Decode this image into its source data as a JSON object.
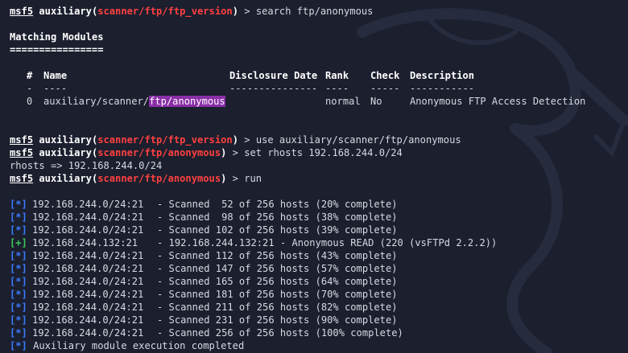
{
  "prompt": {
    "name": "msf5",
    "module_type": "auxiliary",
    "search_module": "scanner/ftp/ftp_version",
    "use_module": "scanner/ftp/anonymous"
  },
  "commands": {
    "search": "search ftp/anonymous",
    "use": "use auxiliary/scanner/ftp/anonymous",
    "set": "set rhosts 192.168.244.0/24",
    "run": "run"
  },
  "matching_modules": {
    "title": "Matching Modules",
    "underline": "================",
    "headers": {
      "index": "#",
      "name": "Name",
      "disclosure_date": "Disclosure Date",
      "rank": "Rank",
      "check": "Check",
      "description": "Description"
    },
    "dividers": {
      "index": "-",
      "name": "----",
      "disclosure_date": "---------------",
      "rank": "----",
      "check": "-----",
      "description": "-----------"
    },
    "row": {
      "index": "0",
      "name_prefix": "auxiliary/scanner/",
      "name_highlight": "ftp/anonymous",
      "disclosure_date": "",
      "rank": "normal",
      "check": "No",
      "description": "Anonymous FTP Access Detection"
    }
  },
  "rhosts_echo": "rhosts => 192.168.244.0/24",
  "output": [
    {
      "tag": "[*]",
      "type": "info",
      "host": "192.168.244.0/24:21",
      "msg": "- Scanned  52 of 256 hosts (20% complete)"
    },
    {
      "tag": "[*]",
      "type": "info",
      "host": "192.168.244.0/24:21",
      "msg": "- Scanned  98 of 256 hosts (38% complete)"
    },
    {
      "tag": "[*]",
      "type": "info",
      "host": "192.168.244.0/24:21",
      "msg": "- Scanned 102 of 256 hosts (39% complete)"
    },
    {
      "tag": "[+]",
      "type": "good",
      "host": "192.168.244.132:21",
      "msg": "- 192.168.244.132:21 - Anonymous READ (220 (vsFTPd 2.2.2))"
    },
    {
      "tag": "[*]",
      "type": "info",
      "host": "192.168.244.0/24:21",
      "msg": "- Scanned 112 of 256 hosts (43% complete)"
    },
    {
      "tag": "[*]",
      "type": "info",
      "host": "192.168.244.0/24:21",
      "msg": "- Scanned 147 of 256 hosts (57% complete)"
    },
    {
      "tag": "[*]",
      "type": "info",
      "host": "192.168.244.0/24:21",
      "msg": "- Scanned 165 of 256 hosts (64% complete)"
    },
    {
      "tag": "[*]",
      "type": "info",
      "host": "192.168.244.0/24:21",
      "msg": "- Scanned 181 of 256 hosts (70% complete)"
    },
    {
      "tag": "[*]",
      "type": "info",
      "host": "192.168.244.0/24:21",
      "msg": "- Scanned 211 of 256 hosts (82% complete)"
    },
    {
      "tag": "[*]",
      "type": "info",
      "host": "192.168.244.0/24:21",
      "msg": "- Scanned 231 of 256 hosts (90% complete)"
    },
    {
      "tag": "[*]",
      "type": "info",
      "host": "192.168.244.0/24:21",
      "msg": "- Scanned 256 of 256 hosts (100% complete)"
    },
    {
      "tag": "[*]",
      "type": "info",
      "host": "",
      "msg": "Auxiliary module execution completed"
    }
  ],
  "colors": {
    "background": "#1b1f2e",
    "prompt_red": "#ff4040",
    "highlight": "#8a2fa8",
    "info_blue": "#3b7cff",
    "good_green": "#3cc85a"
  }
}
